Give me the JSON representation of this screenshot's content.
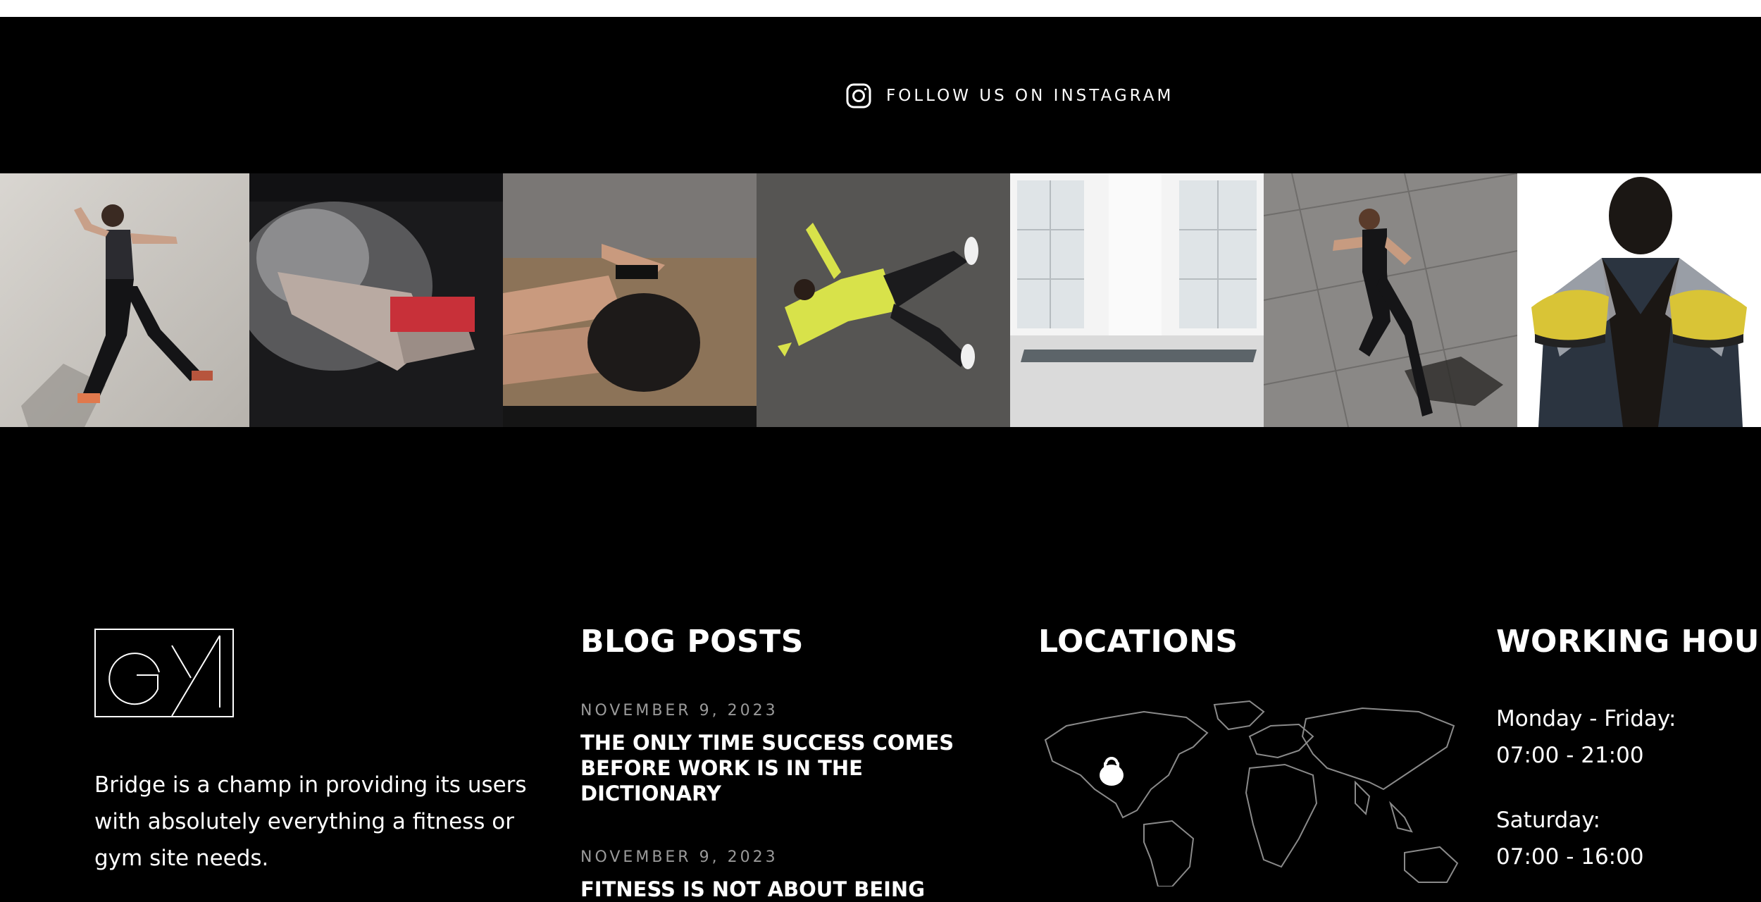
{
  "instagram": {
    "label": "FOLLOW US ON INSTAGRAM",
    "icon": "instagram-icon"
  },
  "gallery": [
    {
      "name": "photo-woman-running"
    },
    {
      "name": "photo-chalk-hands"
    },
    {
      "name": "photo-woman-situps"
    },
    {
      "name": "photo-man-lying-yellow"
    },
    {
      "name": "photo-empty-studio"
    },
    {
      "name": "photo-woman-running-aerial"
    },
    {
      "name": "photo-man-holding-shoes"
    }
  ],
  "footer": {
    "about": {
      "logo": "GYM",
      "text": "Bridge is a champ in providing its users with absolutely everything a fitness or gym site needs."
    },
    "blog": {
      "title": "BLOG POSTS",
      "posts": [
        {
          "date": "NOVEMBER 9, 2023",
          "title": "THE ONLY TIME SUCCESS COMES BEFORE WORK IS IN THE DICTIONARY"
        },
        {
          "date": "NOVEMBER 9, 2023",
          "title": "FITNESS IS NOT ABOUT BEING"
        }
      ]
    },
    "locations": {
      "title": "LOCATIONS",
      "marker_icon": "kettlebell-icon"
    },
    "hours": {
      "title": "WORKING HOURS",
      "rows": [
        {
          "days": "Monday - Friday:",
          "time": "07:00 - 21:00"
        },
        {
          "days": "Saturday:",
          "time": "07:00 - 16:00"
        }
      ]
    }
  },
  "colors": {
    "background": "#000000",
    "text": "#ffffff",
    "muted": "#9a9a9a"
  }
}
